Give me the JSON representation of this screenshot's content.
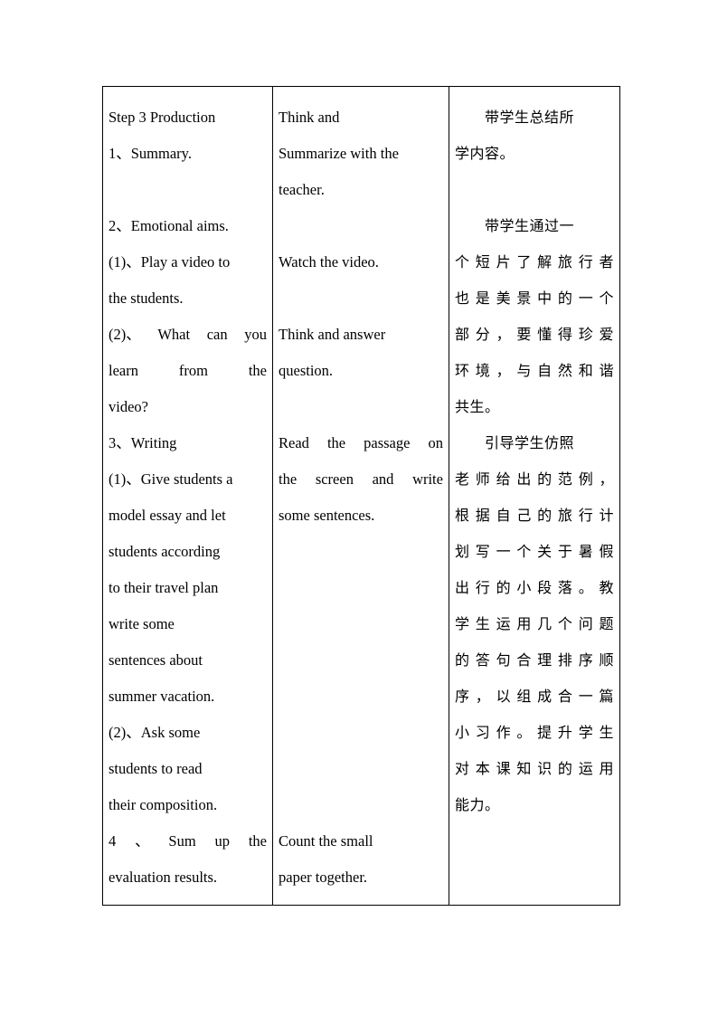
{
  "document": {
    "type": "lesson-plan-table",
    "columns": 3,
    "text_color": "#000000",
    "background_color": "#ffffff",
    "border_color": "#000000"
  },
  "table": {
    "teacher_column": {
      "lines": [
        {
          "text": "Step 3 Production",
          "align": "left"
        },
        {
          "text": "1、Summary.",
          "align": "left"
        },
        {
          "text": "",
          "align": "left"
        },
        {
          "text": "2、Emotional aims.",
          "align": "left"
        },
        {
          "text": "(1)、Play a video to",
          "align": "left"
        },
        {
          "text": "the students.",
          "align": "left"
        },
        {
          "align": "justify",
          "words": [
            "(2)、",
            "What",
            "can",
            "you"
          ]
        },
        {
          "align": "justify",
          "words": [
            "learn",
            "from",
            "the"
          ]
        },
        {
          "text": "video?",
          "align": "left"
        },
        {
          "text": "3、Writing",
          "align": "left"
        },
        {
          "text": "(1)、Give students a",
          "align": "left"
        },
        {
          "text": "model essay and let",
          "align": "left"
        },
        {
          "text": "students according",
          "align": "left"
        },
        {
          "text": "to their travel plan",
          "align": "left"
        },
        {
          "text": "write some",
          "align": "left"
        },
        {
          "text": "sentences about",
          "align": "left"
        },
        {
          "text": "summer vacation.",
          "align": "left"
        },
        {
          "text": "(2)、Ask some",
          "align": "left"
        },
        {
          "text": "students to read",
          "align": "left"
        },
        {
          "text": "their composition.",
          "align": "left"
        },
        {
          "align": "justify",
          "words": [
            "4",
            "、",
            "Sum",
            "up",
            "the"
          ]
        },
        {
          "text": "evaluation results.",
          "align": "left"
        }
      ]
    },
    "student_column": {
      "lines": [
        {
          "text": "Think and",
          "align": "left"
        },
        {
          "text": "Summarize with the",
          "align": "left"
        },
        {
          "text": "teacher.",
          "align": "left"
        },
        {
          "text": "",
          "align": "left"
        },
        {
          "text": "Watch the video.",
          "align": "left"
        },
        {
          "text": "",
          "align": "left"
        },
        {
          "text": "Think and answer",
          "align": "left"
        },
        {
          "text": "question.",
          "align": "left"
        },
        {
          "text": "",
          "align": "left"
        },
        {
          "align": "justify",
          "words": [
            "Read",
            "the",
            "passage",
            "on"
          ]
        },
        {
          "align": "justify",
          "words": [
            "the",
            "screen",
            "and",
            "write"
          ]
        },
        {
          "text": "some sentences.",
          "align": "left"
        },
        {
          "text": "",
          "align": "left"
        },
        {
          "text": "",
          "align": "left"
        },
        {
          "text": "",
          "align": "left"
        },
        {
          "text": "",
          "align": "left"
        },
        {
          "text": "",
          "align": "left"
        },
        {
          "text": "",
          "align": "left"
        },
        {
          "text": "",
          "align": "left"
        },
        {
          "text": "",
          "align": "left"
        },
        {
          "text": "Count the small",
          "align": "left"
        },
        {
          "text": "paper together.",
          "align": "left"
        }
      ]
    },
    "intent_column": {
      "lines": [
        {
          "text": "带学生总结所",
          "align": "indent"
        },
        {
          "text": "学内容。",
          "align": "left"
        },
        {
          "text": "",
          "align": "left"
        },
        {
          "text": "带学生通过一",
          "align": "indent"
        },
        {
          "text": "个短片了解旅行者",
          "align": "justify"
        },
        {
          "text": "也是美景中的一个",
          "align": "justify"
        },
        {
          "text": "部分，要懂得珍爱",
          "align": "justify"
        },
        {
          "text": "环境，与自然和谐",
          "align": "justify"
        },
        {
          "text": "共生。",
          "align": "left"
        },
        {
          "text": "引导学生仿照",
          "align": "indent"
        },
        {
          "text": "老师给出的范例，",
          "align": "justify"
        },
        {
          "text": "根据自己的旅行计",
          "align": "justify"
        },
        {
          "text": "划写一个关于暑假",
          "align": "justify"
        },
        {
          "text": "出行的小段落。教",
          "align": "justify"
        },
        {
          "text": "学生运用几个问题",
          "align": "justify"
        },
        {
          "text": "的答句合理排序顺",
          "align": "justify"
        },
        {
          "text": "序，以组成合一篇",
          "align": "justify"
        },
        {
          "text": "小习作。提升学生",
          "align": "justify"
        },
        {
          "text": "对本课知识的运用",
          "align": "justify"
        },
        {
          "text": "能力。",
          "align": "left"
        },
        {
          "text": "",
          "align": "left"
        },
        {
          "text": "",
          "align": "left"
        }
      ]
    }
  }
}
